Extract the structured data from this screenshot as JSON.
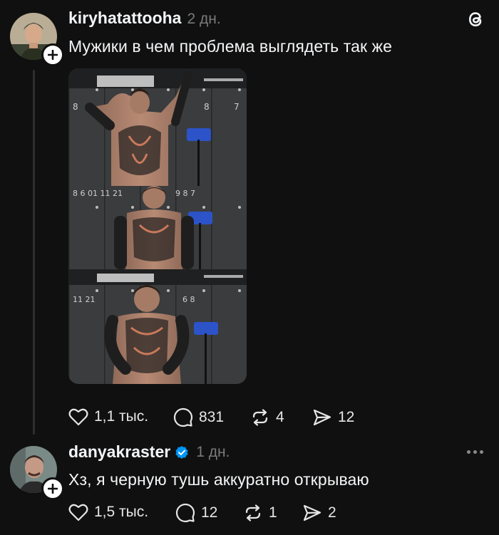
{
  "posts": [
    {
      "username": "kiryhatattooha",
      "time": "2 дн.",
      "text": "Мужики в чем проблема выглядеть так же",
      "photo_alt": "Three stacked gym mirror selfies of a man with a heavily tattooed torso and arms",
      "stats": {
        "likes": "1,1 тыс.",
        "comments": "831",
        "reposts": "4",
        "shares": "12"
      }
    },
    {
      "username": "danyakraster",
      "verified": true,
      "time": "1 дн.",
      "text": "Хз, я черную тушь аккуратно открываю",
      "stats": {
        "likes": "1,5 тыс.",
        "comments": "12",
        "reposts": "1",
        "shares": "2"
      }
    }
  ],
  "colors": {
    "background": "#101010",
    "text": "#f3f5f7",
    "muted": "#7a7a7a",
    "verified": "#0095f6"
  },
  "icons": [
    "threads-logo-icon",
    "plus-icon",
    "heart-icon",
    "comment-icon",
    "repost-icon",
    "share-icon",
    "verified-badge-icon",
    "more-icon"
  ]
}
